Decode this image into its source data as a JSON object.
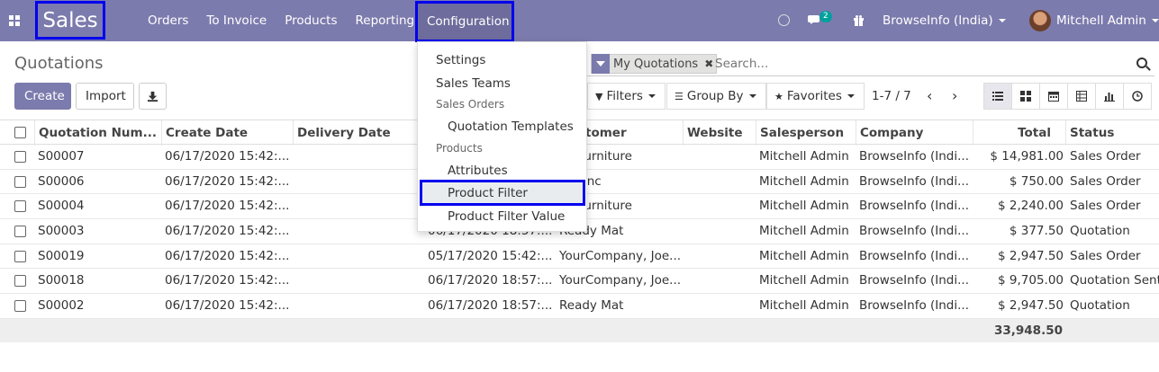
{
  "navbar": {
    "brand": "Sales",
    "menu": [
      "Orders",
      "To Invoice",
      "Products",
      "Reporting",
      "Configuration"
    ],
    "chat_badge": "2",
    "company": "BrowseInfo (India)",
    "user": "Mitchell Admin"
  },
  "page": {
    "title": "Quotations",
    "create_label": "Create",
    "import_label": "Import"
  },
  "search": {
    "facet": "My Quotations",
    "placeholder": "Search..."
  },
  "filters": {
    "filters_label": "Filters",
    "groupby_label": "Group By",
    "favorites_label": "Favorites"
  },
  "pager": "1-7 / 7",
  "dropdown": {
    "settings": "Settings",
    "sales_teams": "Sales Teams",
    "header_sales_orders": "Sales Orders",
    "quotation_templates": "Quotation Templates",
    "header_products": "Products",
    "attributes": "Attributes",
    "product_filter": "Product Filter",
    "product_filter_value": "Product Filter Value"
  },
  "table": {
    "columns": [
      "Quotation Num...",
      "Create Date",
      "Delivery Date",
      "tomer",
      "Website",
      "Salesperson",
      "Company",
      "Total",
      "Status"
    ],
    "rows": [
      {
        "number": "S00007",
        "create": "06/17/2020 15:42:...",
        "expected": "",
        "customer": "ini Furniture",
        "salesperson": "Mitchell Admin",
        "company": "BrowseInfo (Indi...",
        "total": "$ 14,981.00",
        "status": "Sales Order"
      },
      {
        "number": "S00006",
        "create": "06/17/2020 15:42:...",
        "expected": "",
        "customer": "per Inc",
        "salesperson": "Mitchell Admin",
        "company": "BrowseInfo (Indi...",
        "total": "$ 750.00",
        "status": "Sales Order"
      },
      {
        "number": "S00004",
        "create": "06/17/2020 15:42:...",
        "expected": "",
        "customer": "ini Furniture",
        "salesperson": "Mitchell Admin",
        "company": "BrowseInfo (Indi...",
        "total": "$ 2,240.00",
        "status": "Sales Order"
      },
      {
        "number": "S00003",
        "create": "06/17/2020 15:42:...",
        "expected": "06/17/2020 18:57:...",
        "customer": "Ready Mat",
        "salesperson": "Mitchell Admin",
        "company": "BrowseInfo (Indi...",
        "total": "$ 377.50",
        "status": "Quotation"
      },
      {
        "number": "S00019",
        "create": "06/17/2020 15:42:...",
        "expected": "05/17/2020 15:42:...",
        "customer": "YourCompany, Joe...",
        "salesperson": "Mitchell Admin",
        "company": "BrowseInfo (Indi...",
        "total": "$ 2,947.50",
        "status": "Sales Order"
      },
      {
        "number": "S00018",
        "create": "06/17/2020 15:42:...",
        "expected": "06/17/2020 18:57:...",
        "customer": "YourCompany, Joe...",
        "salesperson": "Mitchell Admin",
        "company": "BrowseInfo (Indi...",
        "total": "$ 9,705.00",
        "status": "Quotation Sent"
      },
      {
        "number": "S00002",
        "create": "06/17/2020 15:42:...",
        "expected": "06/17/2020 18:57:...",
        "customer": "Ready Mat",
        "salesperson": "Mitchell Admin",
        "company": "BrowseInfo (Indi...",
        "total": "$ 2,947.50",
        "status": "Quotation"
      }
    ],
    "grand_total": "33,948.50"
  },
  "colors": {
    "brand": "#7c7bad",
    "highlight_border": "#0000ee"
  }
}
